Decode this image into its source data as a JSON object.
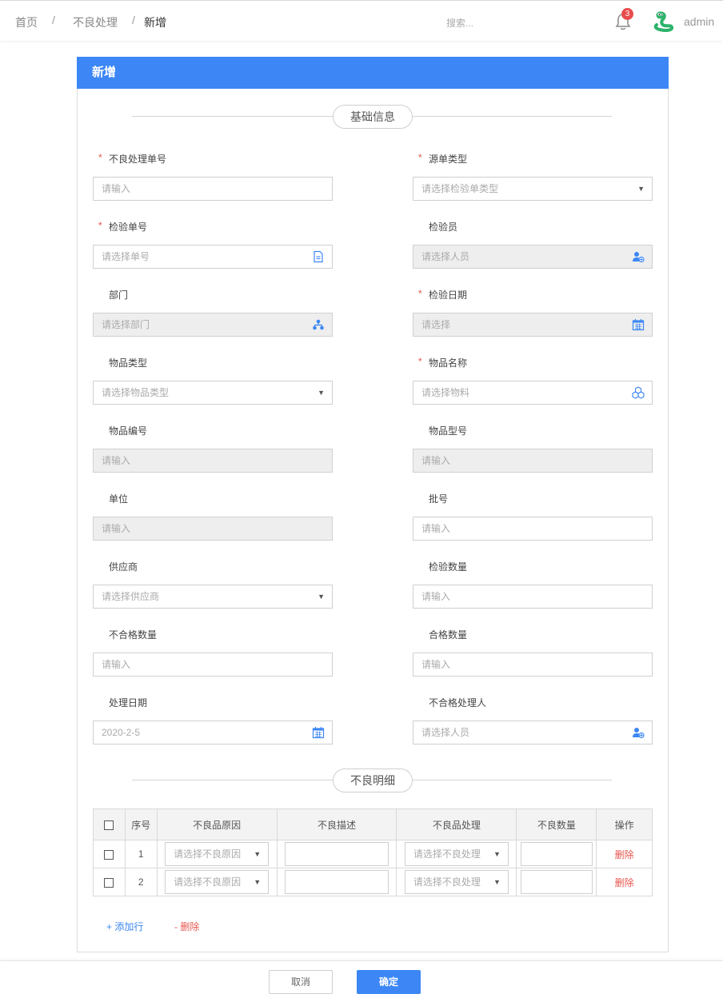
{
  "breadcrumb": {
    "home": "首页",
    "section": "不良处理",
    "current": "新增",
    "separator": "/"
  },
  "search": {
    "placeholder": "搜索..."
  },
  "notifications": {
    "count": "3",
    "icon": "bell-icon"
  },
  "user": {
    "name": "admin",
    "avatar_icon": "snake-avatar-icon"
  },
  "panel": {
    "title": "新增"
  },
  "sections": {
    "basic": "基础信息",
    "detail": "不良明细"
  },
  "form": {
    "required_mark": "*",
    "defect_no": {
      "label": "不良处理单号",
      "placeholder": "请输入"
    },
    "source_type": {
      "label": "源单类型",
      "placeholder": "请选择检验单类型"
    },
    "inspect_no": {
      "label": "检验单号",
      "placeholder": "请选择单号"
    },
    "inspector": {
      "label": "检验员",
      "placeholder": "请选择人员"
    },
    "department": {
      "label": "部门",
      "placeholder": "请选择部门"
    },
    "inspect_date": {
      "label": "检验日期",
      "placeholder": "请选择"
    },
    "item_type": {
      "label": "物品类型",
      "placeholder": "请选择物品类型"
    },
    "item_name": {
      "label": "物品名称",
      "placeholder": "请选择物料"
    },
    "item_code": {
      "label": "物品编号",
      "placeholder": "请输入"
    },
    "item_model": {
      "label": "物品型号",
      "placeholder": "请输入"
    },
    "unit": {
      "label": "单位",
      "placeholder": "请输入"
    },
    "batch_no": {
      "label": "批号",
      "placeholder": "请输入"
    },
    "supplier": {
      "label": "供应商",
      "placeholder": "请选择供应商"
    },
    "inspect_qty": {
      "label": "检验数量",
      "placeholder": "请输入"
    },
    "unqualified_qty": {
      "label": "不合格数量",
      "placeholder": "请输入"
    },
    "qualified_qty": {
      "label": "合格数量",
      "placeholder": "请输入"
    },
    "handle_date": {
      "label": "处理日期",
      "value": "2020-2-5"
    },
    "handler": {
      "label": "不合格处理人",
      "placeholder": "请选择人员"
    }
  },
  "table": {
    "headers": [
      "序号",
      "不良品原因",
      "不良描述",
      "不良品处理",
      "不良数量",
      "操作"
    ],
    "rows": [
      {
        "index": "1",
        "reason_placeholder": "请选择不良原因",
        "handling_placeholder": "请选择不良处理",
        "action": "删除"
      },
      {
        "index": "2",
        "reason_placeholder": "请选择不良原因",
        "handling_placeholder": "请选择不良处理",
        "action": "删除"
      }
    ]
  },
  "table_actions": {
    "add_row": "+ 添加行",
    "delete_row": "- 删除"
  },
  "buttons": {
    "cancel": "取消",
    "confirm": "确定"
  },
  "colors": {
    "primary": "#3c87f5",
    "danger": "#e8554e",
    "disabled_bg": "#eeeeee"
  }
}
